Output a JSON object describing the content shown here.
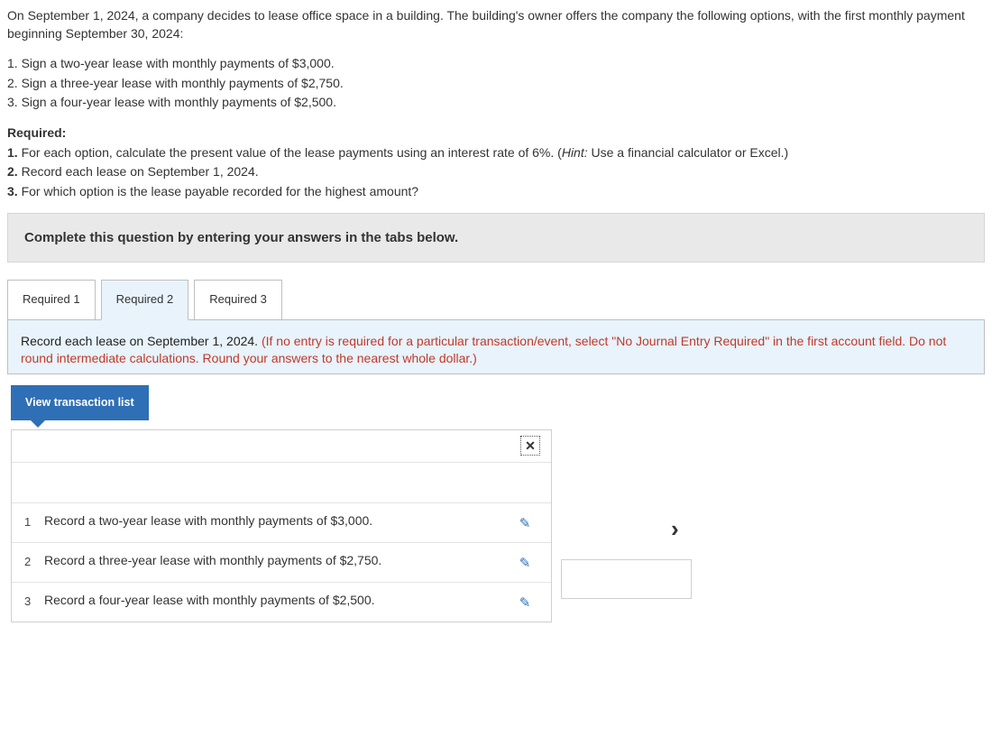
{
  "problem": {
    "intro": "On September 1, 2024, a company decides to lease office space in a building. The building's owner offers the company the following options, with the first monthly payment beginning September 30, 2024:",
    "opt1": "1. Sign a two-year lease with monthly payments of $3,000.",
    "opt2": "2. Sign a three-year lease with monthly payments of $2,750.",
    "opt3": "3. Sign a four-year lease with monthly payments of $2,500.",
    "required_label": "Required:",
    "req1a": "1.",
    "req1b": " For each option, calculate the present value of the lease payments using an interest rate of 6%. (",
    "req1c": "Hint:",
    "req1d": " Use a financial calculator or Excel.)",
    "req2a": "2.",
    "req2b": " Record each lease on September 1, 2024.",
    "req3a": "3.",
    "req3b": " For which option is the lease payable recorded for the highest amount?"
  },
  "instruction_bar": "Complete this question by entering your answers in the tabs below.",
  "tabs": {
    "t1": "Required 1",
    "t2": "Required 2",
    "t3": "Required 3"
  },
  "panel": {
    "main": "Record each lease on September 1, 2024. ",
    "red": "(If no entry is required for a particular transaction/event, select \"No Journal Entry Required\" in the first account field. Do not round intermediate calculations. Round your answers to the nearest whole dollar.)"
  },
  "view_btn": "View transaction list",
  "close_glyph": "✕",
  "transactions": {
    "r1n": "1",
    "r1t": "Record a two-year lease with monthly payments of $3,000.",
    "r2n": "2",
    "r2t": "Record a three-year lease with monthly payments of $2,750.",
    "r3n": "3",
    "r3t": "Record a four-year lease with monthly payments of $2,500."
  },
  "pencil_glyph": "✎",
  "chevron_glyph": "›"
}
